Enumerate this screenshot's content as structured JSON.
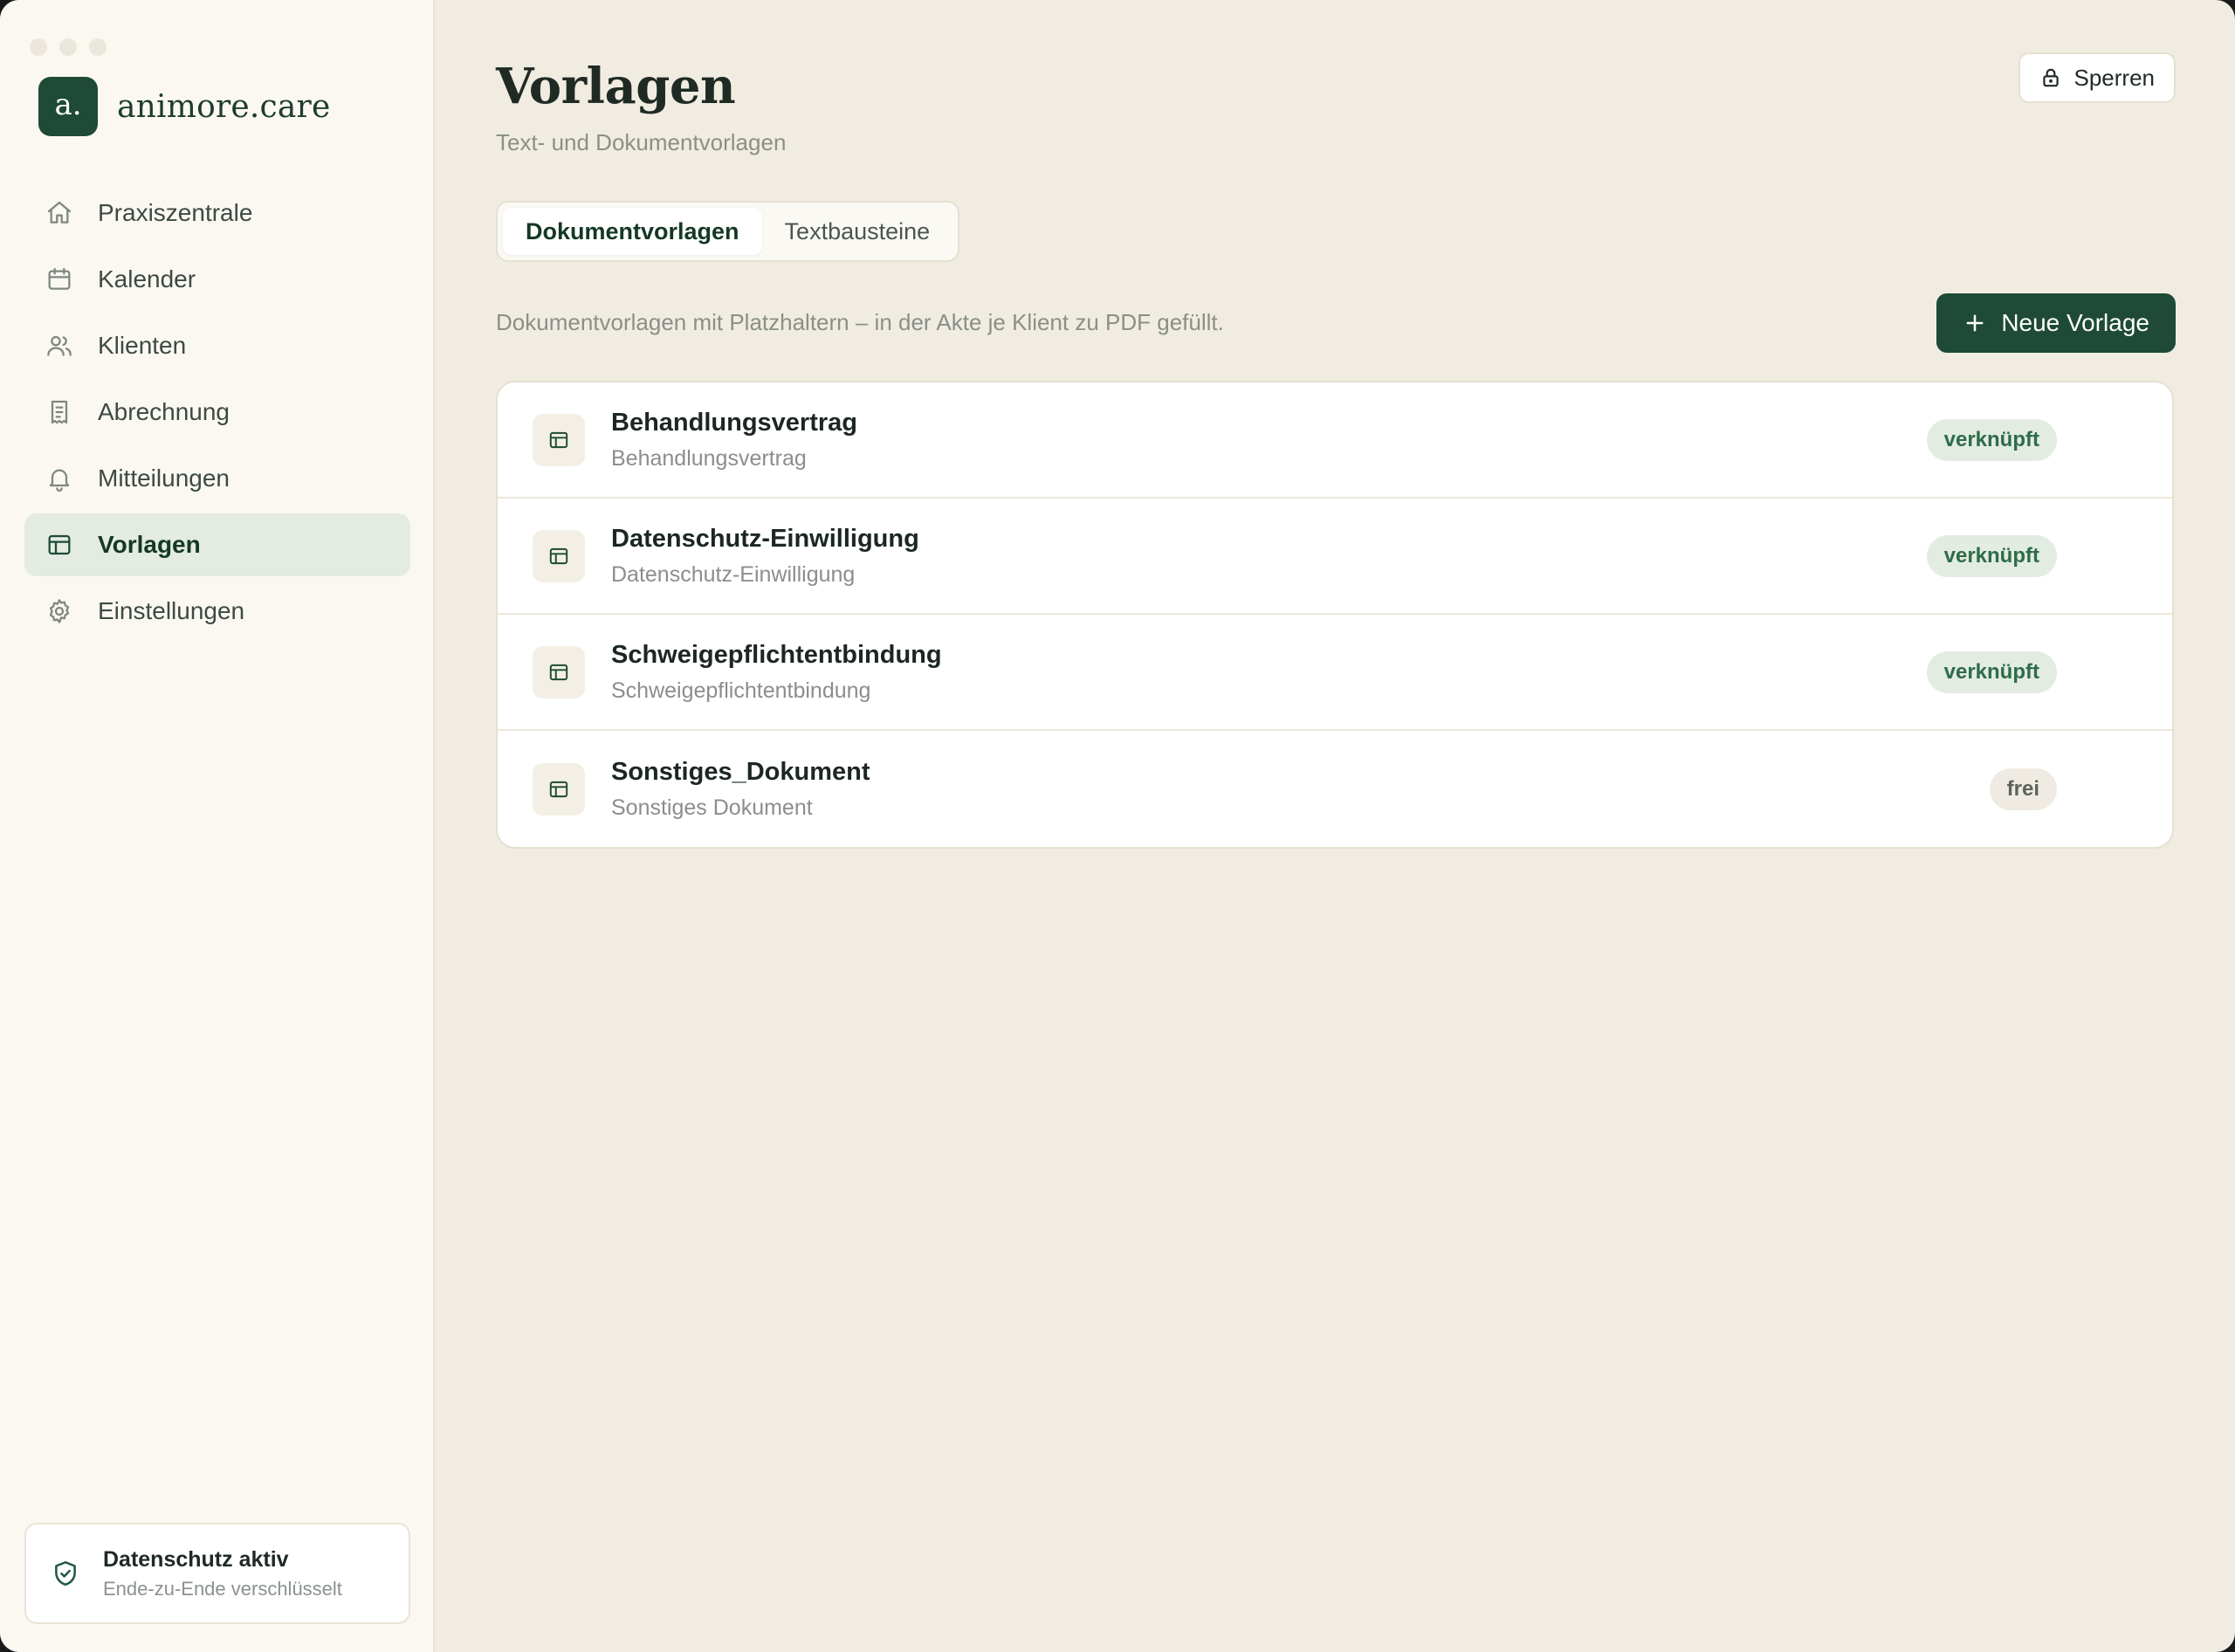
{
  "brand": {
    "mark": "a.",
    "name": "animore.care"
  },
  "sidebar": {
    "items": [
      {
        "label": "Praxiszentrale",
        "icon": "home-icon",
        "active": false
      },
      {
        "label": "Kalender",
        "icon": "calendar-icon",
        "active": false
      },
      {
        "label": "Klienten",
        "icon": "users-icon",
        "active": false
      },
      {
        "label": "Abrechnung",
        "icon": "receipt-icon",
        "active": false
      },
      {
        "label": "Mitteilungen",
        "icon": "bell-icon",
        "active": false
      },
      {
        "label": "Vorlagen",
        "icon": "template-icon",
        "active": true
      },
      {
        "label": "Einstellungen",
        "icon": "gear-icon",
        "active": false
      }
    ],
    "privacy": {
      "title": "Datenschutz aktiv",
      "subtitle": "Ende-zu-Ende verschlüsselt",
      "icon": "shield-check-icon"
    }
  },
  "header": {
    "title": "Vorlagen",
    "subtitle": "Text- und Dokumentvorlagen",
    "lock_label": "Sperren"
  },
  "tabs": [
    {
      "label": "Dokumentvorlagen",
      "active": true
    },
    {
      "label": "Textbausteine",
      "active": false
    }
  ],
  "toolbar": {
    "description": "Dokumentvorlagen mit Platzhaltern – in der Akte je Klient zu PDF gefüllt.",
    "new_label": "Neue Vorlage"
  },
  "templates": [
    {
      "title": "Behandlungsvertrag",
      "subtitle": "Behandlungsvertrag",
      "status": "verknüpft",
      "status_type": "linked"
    },
    {
      "title": "Datenschutz-Einwilligung",
      "subtitle": "Datenschutz-Einwilligung",
      "status": "verknüpft",
      "status_type": "linked"
    },
    {
      "title": "Schweigepflichtentbindung",
      "subtitle": "Schweigepflichtentbindung",
      "status": "verknüpft",
      "status_type": "linked"
    },
    {
      "title": "Sonstiges_Dokument",
      "subtitle": "Sonstiges Dokument",
      "status": "frei",
      "status_type": "free"
    }
  ],
  "colors": {
    "accent": "#1e4a37",
    "background": "#f1ece1",
    "sidebar": "#fbf8f2",
    "badge_linked_bg": "#e2ece2",
    "badge_linked_text": "#2f6b4a"
  }
}
